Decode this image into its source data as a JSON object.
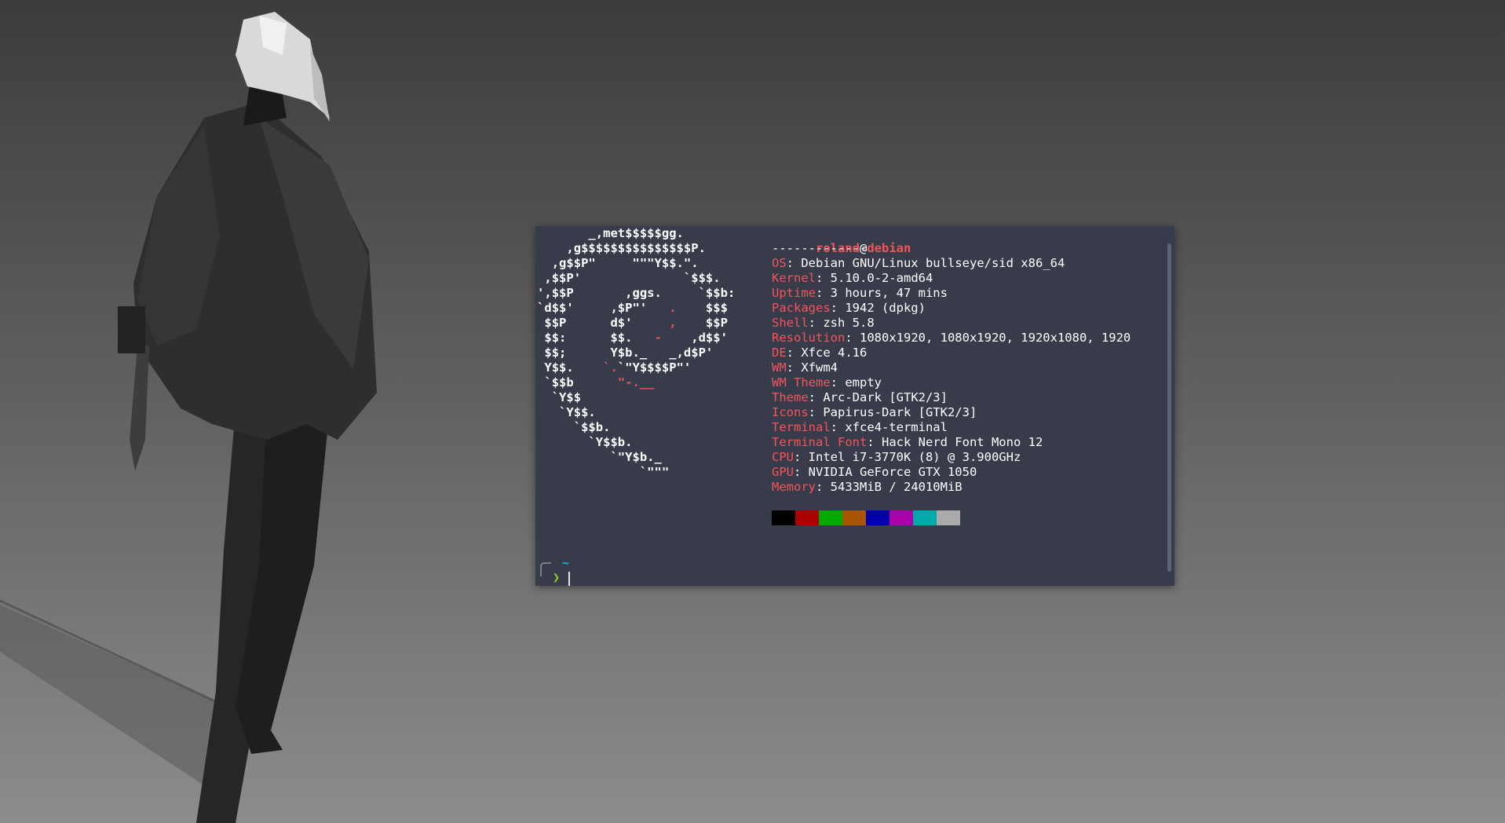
{
  "terminal": {
    "ascii_logo": [
      "       _,met$$$$$gg.",
      "    ,g$$$$$$$$$$$$$$$P.",
      "  ,g$$P\"     \"\"\"Y$$.\".",
      " ,$$P'              `$$$.",
      "',$$P       ,ggs.     `$$b:",
      "`d$$'     ,$P\"'   .    $$$",
      " $$P      d$'     ,    $$P",
      " $$:      $$.   -    ,d$$'",
      " $$;      Y$b._   _,d$P'",
      " Y$$.    `.`\"Y$$$$P\"'",
      " `$$b      \"-.__",
      "  `Y$$",
      "   `Y$$.",
      "     `$$b.",
      "       `Y$$b.",
      "          `\"Y$b._",
      "              `\"\"\""
    ],
    "user": "roland",
    "at": "@",
    "host": "debian",
    "separator": "-------------",
    "info": [
      {
        "key": "OS",
        "value": "Debian GNU/Linux bullseye/sid x86_64"
      },
      {
        "key": "Kernel",
        "value": "5.10.0-2-amd64"
      },
      {
        "key": "Uptime",
        "value": "3 hours, 47 mins"
      },
      {
        "key": "Packages",
        "value": "1942 (dpkg)"
      },
      {
        "key": "Shell",
        "value": "zsh 5.8"
      },
      {
        "key": "Resolution",
        "value": "1080x1920, 1080x1920, 1920x1080, 1920"
      },
      {
        "key": "DE",
        "value": "Xfce 4.16"
      },
      {
        "key": "WM",
        "value": "Xfwm4"
      },
      {
        "key": "WM Theme",
        "value": "empty"
      },
      {
        "key": "Theme",
        "value": "Arc-Dark [GTK2/3]"
      },
      {
        "key": "Icons",
        "value": "Papirus-Dark [GTK2/3]"
      },
      {
        "key": "Terminal",
        "value": "xfce4-terminal"
      },
      {
        "key": "Terminal Font",
        "value": "Hack Nerd Font Mono 12"
      },
      {
        "key": "CPU",
        "value": "Intel i7-3770K (8) @ 3.900GHz"
      },
      {
        "key": "GPU",
        "value": "NVIDIA GeForce GTX 1050"
      },
      {
        "key": "Memory",
        "value": "5433MiB / 24010MiB"
      }
    ],
    "palette": [
      "#000000",
      "#aa0000",
      "#00aa00",
      "#aa5500",
      "#0000aa",
      "#aa00aa",
      "#00aaaa",
      "#aaaaaa"
    ],
    "prompt": {
      "dir": "~",
      "arrow": "❯",
      "arrow_icon": "prompt-arrow-icon"
    },
    "colors": {
      "background": "#383c4a",
      "key": "#f2545b",
      "dir": "#17b5e0",
      "arrow": "#8ccf3e"
    }
  },
  "wallpaper": {
    "subject": "hooded-figure-with-bird-skull-mask"
  }
}
